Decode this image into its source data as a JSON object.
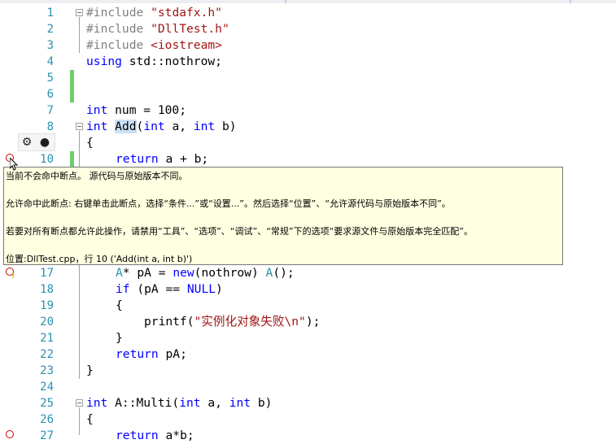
{
  "colors": {
    "line_number": "#2b91af",
    "keyword": "#0000ff",
    "string": "#a31515",
    "preprocessor": "#808080",
    "type": "#2b91af",
    "change_bar": "#6ece6a",
    "breakpoint": "#cc0000",
    "tooltip_bg": "#ffffe1"
  },
  "lines": [
    {
      "num": "1"
    },
    {
      "num": "2"
    },
    {
      "num": "3"
    },
    {
      "num": "4"
    },
    {
      "num": "5"
    },
    {
      "num": "6"
    },
    {
      "num": "7"
    },
    {
      "num": "8"
    },
    {
      "num": "9"
    },
    {
      "num": "10"
    },
    {
      "num": "17"
    },
    {
      "num": "18"
    },
    {
      "num": "19"
    },
    {
      "num": "20"
    },
    {
      "num": "21"
    },
    {
      "num": "22"
    },
    {
      "num": "23"
    },
    {
      "num": "24"
    },
    {
      "num": "25"
    },
    {
      "num": "26"
    },
    {
      "num": "27"
    }
  ],
  "code": {
    "l1": {
      "kw": "#include",
      "arg": "\"stdafx.h\""
    },
    "l2": {
      "kw": "#include",
      "arg": "\"DllTest.h\""
    },
    "l3": {
      "kw": "#include",
      "arg": "<iostream>"
    },
    "l4": {
      "kw": "using",
      "rest": " std::nothrow;"
    },
    "l7": {
      "kw": "int",
      "rest": " num = 100;"
    },
    "l8": {
      "kw1": "int",
      "name": "Add",
      "p1": "(",
      "kw2": "int",
      "a": " a, ",
      "kw3": "int",
      "b": " b)"
    },
    "l9": {
      "text": "{"
    },
    "l10": {
      "kw": "return",
      "rest": " a + b;"
    },
    "l17": {
      "ty": "A",
      "mid": "* pA = ",
      "kw": "new",
      "open": "(nothrow) ",
      "ty2": "A",
      "end": "();"
    },
    "l18": {
      "kw": "if",
      "mid": " (pA == ",
      "nul": "NULL",
      "end": ")"
    },
    "l19": {
      "text": "{"
    },
    "l20": {
      "fn": "printf(",
      "str": "\"实例化对象失败\\n\"",
      "end": ");"
    },
    "l21": {
      "text": "}"
    },
    "l22": {
      "kw": "return",
      "rest": " pA;"
    },
    "l23": {
      "text": "}"
    },
    "l25": {
      "kw1": "int",
      "mid": " A::Multi(",
      "kw2": "int",
      "a": " a, ",
      "kw3": "int",
      "b": " b)"
    },
    "l26": {
      "text": "{"
    },
    "l27": {
      "kw": "return",
      "rest": " a*b;"
    }
  },
  "toolbar": {
    "settings_icon": "gear-icon",
    "toggle_icon": "breakpoint-toggle-icon"
  },
  "tooltip": {
    "line1": "当前不会命中断点。 源代码与原始版本不同。",
    "line2": "允许命中此断点: 右键单击此断点，选择“条件...”或“设置...”。然后选择“位置”、“允许源代码与原始版本不同”。",
    "line3": "若要对所有断点都允许此操作，请禁用“工具”、“选项”、“调试”、“常规”下的选项“要求源文件与原始版本完全匹配”。",
    "line4": "位置:DllTest.cpp，行 10 ('Add(int a, int b)')"
  }
}
